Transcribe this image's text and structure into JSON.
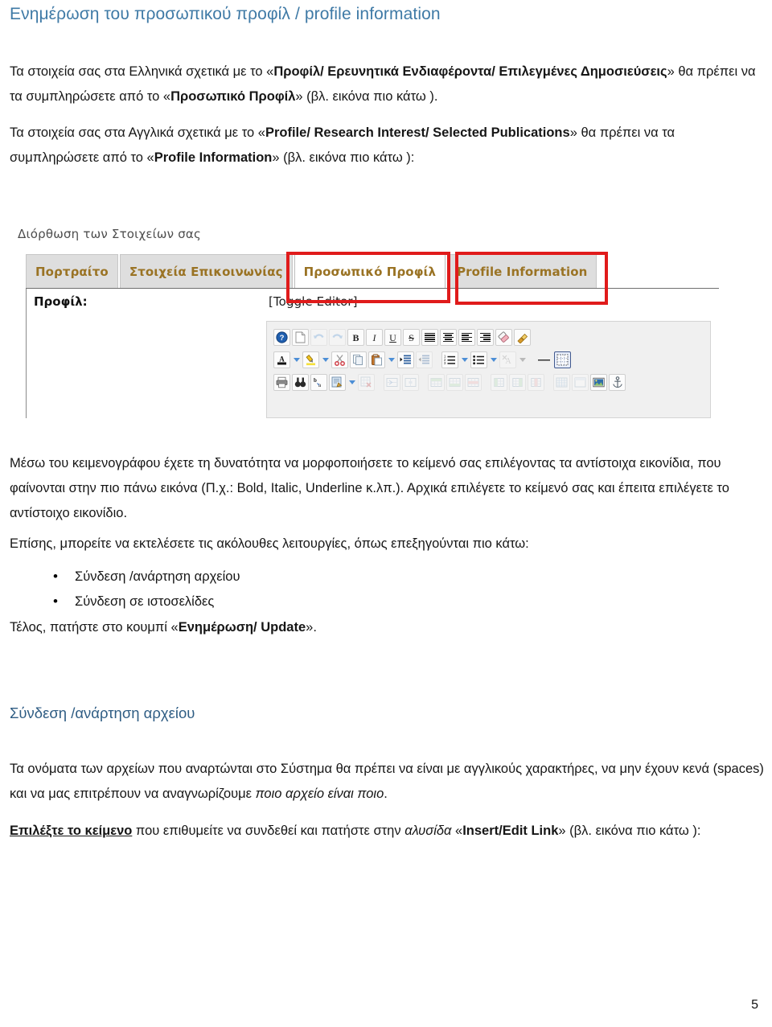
{
  "document": {
    "page_number": "5",
    "heading_main": "Ενημέρωση του προσωπικού προφίλ / profile information",
    "heading_sub": "Σύνδεση /ανάρτηση αρχείου",
    "colors": {
      "heading_main": "#3f7aa6",
      "heading_sub": "#2f5d84",
      "annotation_red": "#e01b1b",
      "tab_label": "#9a7324",
      "body_text": "#161616"
    }
  },
  "paragraphs": {
    "greek_profile": {
      "p1": "Τα στοιχεία σας  στα Ελληνικά σχετικά με το «",
      "b1": "Προφίλ/ Ερευνητικά Ενδιαφέροντα/ Επιλεγμένες Δημοσιεύσεις",
      "p2": "» θα πρέπει να τα συμπληρώσετε από το «",
      "b2": "Προσωπικό Προφίλ",
      "p3": "»  (βλ. εικόνα πιο κάτω )."
    },
    "english_profile": {
      "p1": "Τα στοιχεία σας στα Αγγλικά σχετικά με το «",
      "b1": "Profile/ Research Interest/ Selected Publications",
      "p2": "» θα πρέπει να τα συμπληρώσετε από το «",
      "b2": "Profile Information",
      "p3": "» (βλ. εικόνα πιο κάτω ):"
    },
    "editor_usage": {
      "p1": "Μέσω του κειμενογράφου έχετε τη δυνατότητα να μορφοποιήσετε το κείμενό σας επιλέγοντας τα αντίστοιχα εικονίδια, που φαίνονται στην πιο  πάνω εικόνα (Π.χ.: Bold, Italic, Underline κ.λπ.). Αρχικά επιλέγετε το κείμενό σας και έπειτα επιλέγετε το αντίστοιχο εικονίδιο."
    },
    "also_intro": {
      "p1": "Επίσης, μπορείτε να εκτελέσετε τις ακόλουθες λειτουργίες, όπως επεξηγούνται πιο κάτω:"
    },
    "final_note": {
      "p1": "Τέλος, πατήστε στο κουμπί «",
      "b1": "Ενημέρωση/ Update",
      "p2": "»."
    },
    "file_names": {
      "p1": "Τα ονόματα των αρχείων που αναρτώνται στο Σύστημα θα πρέπει να είναι με αγγλικούς χαρακτήρες, να μην έχουν κενά (spaces) και να μας επιτρέπουν να αναγνωρίζουμε ",
      "i1": "ποιο αρχείο είναι ποιο",
      "p2": "."
    },
    "select_text": {
      "u1": "Επιλέξτε το κείμενο",
      "p1": " που επιθυμείτε να συνδεθεί και πατήστε στην ",
      "i1": "αλυσίδα",
      "p2": " «",
      "b1": "Insert/Edit Link",
      "p3": "» (βλ. εικόνα πιο κάτω ):"
    }
  },
  "bullets": [
    "Σύνδεση /ανάρτηση αρχείου",
    "Σύνδεση σε ιστοσελίδες"
  ],
  "screenshot": {
    "caption": "Διόρθωση των Στοιχείων σας",
    "tabs": [
      {
        "label": "Πορτραίτο",
        "active": false,
        "highlighted": false
      },
      {
        "label": "Στοιχεία Επικοινωνίας",
        "active": false,
        "highlighted": false
      },
      {
        "label": "Προσωπικό Προφίλ",
        "active": true,
        "highlighted": true
      },
      {
        "label": "Profile Information",
        "active": false,
        "highlighted": true
      }
    ],
    "field_label": "Προφίλ:",
    "toggle_editor": "[Toggle Editor]",
    "toolbar_rows": [
      [
        {
          "icon": "help-icon",
          "glyph": "?"
        },
        {
          "icon": "new-document-icon",
          "glyph": ""
        },
        {
          "icon": "undo-icon",
          "glyph": ""
        },
        {
          "icon": "redo-icon",
          "glyph": ""
        },
        {
          "icon": "bold-icon",
          "glyph": "B"
        },
        {
          "icon": "italic-icon",
          "glyph": "I"
        },
        {
          "icon": "underline-icon",
          "glyph": "U"
        },
        {
          "icon": "strikethrough-icon",
          "glyph": "S"
        },
        {
          "icon": "align-justify-icon",
          "glyph": ""
        },
        {
          "icon": "align-center-icon",
          "glyph": ""
        },
        {
          "icon": "align-left-icon",
          "glyph": ""
        },
        {
          "icon": "align-right-icon",
          "glyph": ""
        },
        {
          "icon": "eraser-icon",
          "glyph": ""
        },
        {
          "icon": "format-painter-icon",
          "glyph": ""
        }
      ],
      [
        {
          "icon": "text-color-icon",
          "glyph": "A"
        },
        {
          "icon": "highlight-color-icon",
          "glyph": ""
        },
        {
          "icon": "cut-icon",
          "glyph": ""
        },
        {
          "icon": "copy-icon",
          "glyph": ""
        },
        {
          "icon": "paste-icon",
          "glyph": ""
        },
        {
          "icon": "indent-increase-icon",
          "glyph": ""
        },
        {
          "icon": "indent-decrease-icon",
          "glyph": ""
        },
        {
          "icon": "numbered-list-icon",
          "glyph": ""
        },
        {
          "icon": "bulleted-list-icon",
          "glyph": ""
        },
        {
          "icon": "remove-format-icon",
          "glyph": ""
        },
        {
          "icon": "horizontal-rule-icon",
          "glyph": ""
        },
        {
          "icon": "show-borders-icon",
          "glyph": ""
        }
      ],
      [
        {
          "icon": "print-icon",
          "glyph": ""
        },
        {
          "icon": "find-icon",
          "glyph": ""
        },
        {
          "icon": "replace-icon",
          "glyph": ""
        },
        {
          "icon": "edit-source-icon",
          "glyph": ""
        },
        {
          "icon": "delete-table-icon",
          "glyph": ""
        },
        {
          "icon": "merge-cells-icon",
          "glyph": ""
        },
        {
          "icon": "split-cells-icon",
          "glyph": ""
        },
        {
          "icon": "insert-row-above-icon",
          "glyph": ""
        },
        {
          "icon": "insert-row-below-icon",
          "glyph": ""
        },
        {
          "icon": "delete-row-icon",
          "glyph": ""
        },
        {
          "icon": "insert-column-left-icon",
          "glyph": ""
        },
        {
          "icon": "insert-column-right-icon",
          "glyph": ""
        },
        {
          "icon": "delete-column-icon",
          "glyph": ""
        },
        {
          "icon": "insert-table-icon",
          "glyph": ""
        },
        {
          "icon": "table-properties-icon",
          "glyph": ""
        },
        {
          "icon": "insert-image-icon",
          "glyph": ""
        },
        {
          "icon": "insert-anchor-icon",
          "glyph": ""
        }
      ]
    ]
  }
}
